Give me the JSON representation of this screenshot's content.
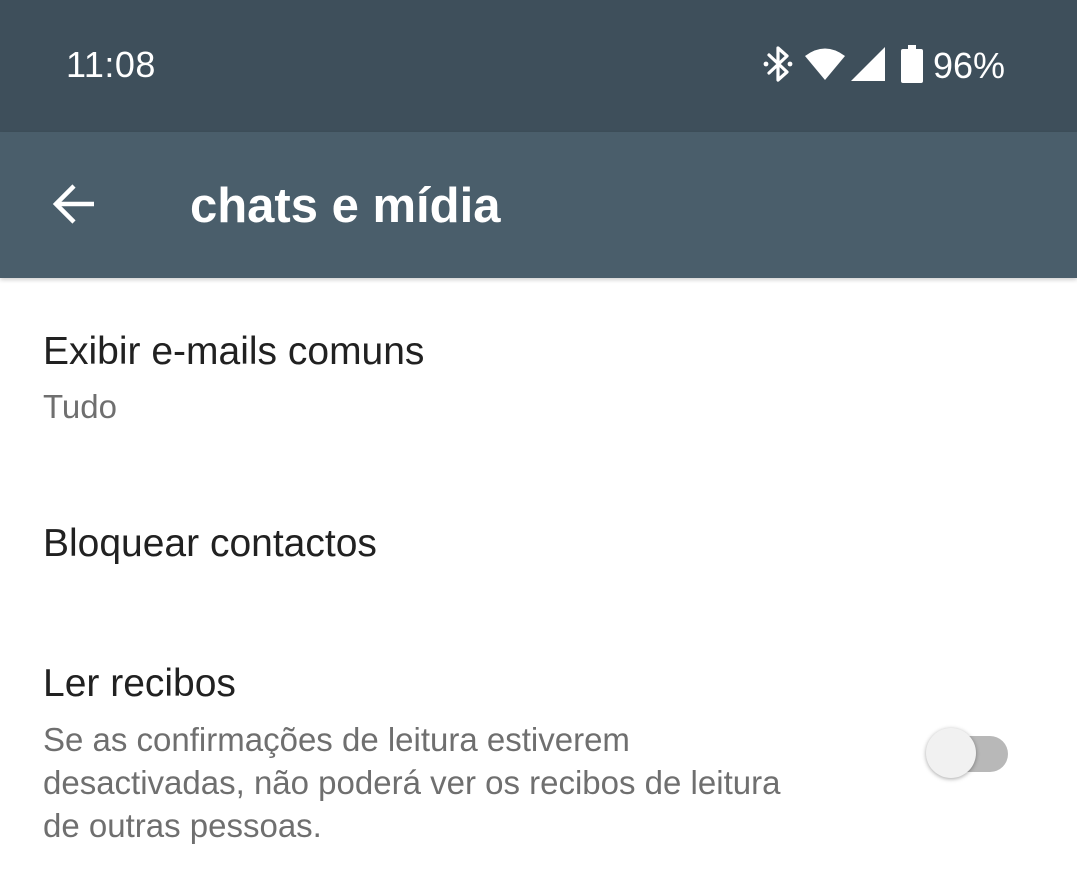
{
  "status_bar": {
    "time": "11:08",
    "icons": [
      "bluetooth-icon",
      "wifi-icon",
      "cell-signal-icon",
      "battery-icon"
    ],
    "battery": "96%"
  },
  "app_bar": {
    "back_icon": "arrow-left-icon",
    "title": "chats e mídia"
  },
  "settings": {
    "common_emails": {
      "title": "Exibir e-mails comuns",
      "value": "Tudo"
    },
    "block_contacts": {
      "title": "Bloquear contactos"
    },
    "read_receipts": {
      "title": "Ler recibos",
      "description_lines": [
        "Se as confirmações de leitura estiverem",
        "desactivadas, não poderá ver os recibos de leitura",
        "de outras pessoas."
      ],
      "enabled": false
    }
  },
  "colors": {
    "status_bar": "#3e4f5b",
    "app_bar": "#4a5e6b",
    "primary_text": "#212121",
    "secondary_text": "#6f6f6f",
    "toggle_track_off": "#b8b8b8",
    "toggle_thumb_off": "#f1f1f1"
  }
}
